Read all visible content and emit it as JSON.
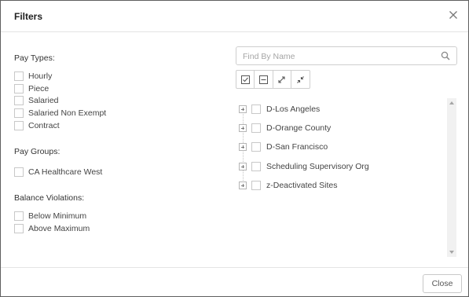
{
  "dialog": {
    "title": "Filters"
  },
  "pay_types": {
    "label": "Pay Types:",
    "options": [
      {
        "label": "Hourly",
        "checked": false
      },
      {
        "label": "Piece",
        "checked": false
      },
      {
        "label": "Salaried",
        "checked": false
      },
      {
        "label": "Salaried Non Exempt",
        "checked": false
      },
      {
        "label": "Contract",
        "checked": false
      }
    ]
  },
  "pay_groups": {
    "label": "Pay Groups:",
    "options": [
      {
        "label": "CA Healthcare West",
        "checked": false
      }
    ]
  },
  "balance_violations": {
    "label": "Balance Violations:",
    "options": [
      {
        "label": "Below Minimum",
        "checked": false
      },
      {
        "label": "Above Maximum",
        "checked": false
      }
    ]
  },
  "search": {
    "placeholder": "Find By Name",
    "value": "",
    "icon": "search-icon"
  },
  "toolbar": {
    "buttons": [
      {
        "icon": "select-all-icon"
      },
      {
        "icon": "deselect-all-icon"
      },
      {
        "icon": "expand-all-icon"
      },
      {
        "icon": "collapse-all-icon"
      }
    ]
  },
  "tree": {
    "items": [
      {
        "label": "D-Los Angeles",
        "checked": false
      },
      {
        "label": "D-Orange County",
        "checked": false
      },
      {
        "label": "D-San Francisco",
        "checked": false
      },
      {
        "label": "Scheduling Supervisory Org",
        "checked": false
      },
      {
        "label": "z-Deactivated Sites",
        "checked": false
      }
    ]
  },
  "footer": {
    "close_label": "Close"
  },
  "colors": {
    "border": "#5f5f5f",
    "divider": "#e4e4e4",
    "checkbox_border": "#c8c8c8",
    "scrollbar_track": "#f1f1f1"
  }
}
